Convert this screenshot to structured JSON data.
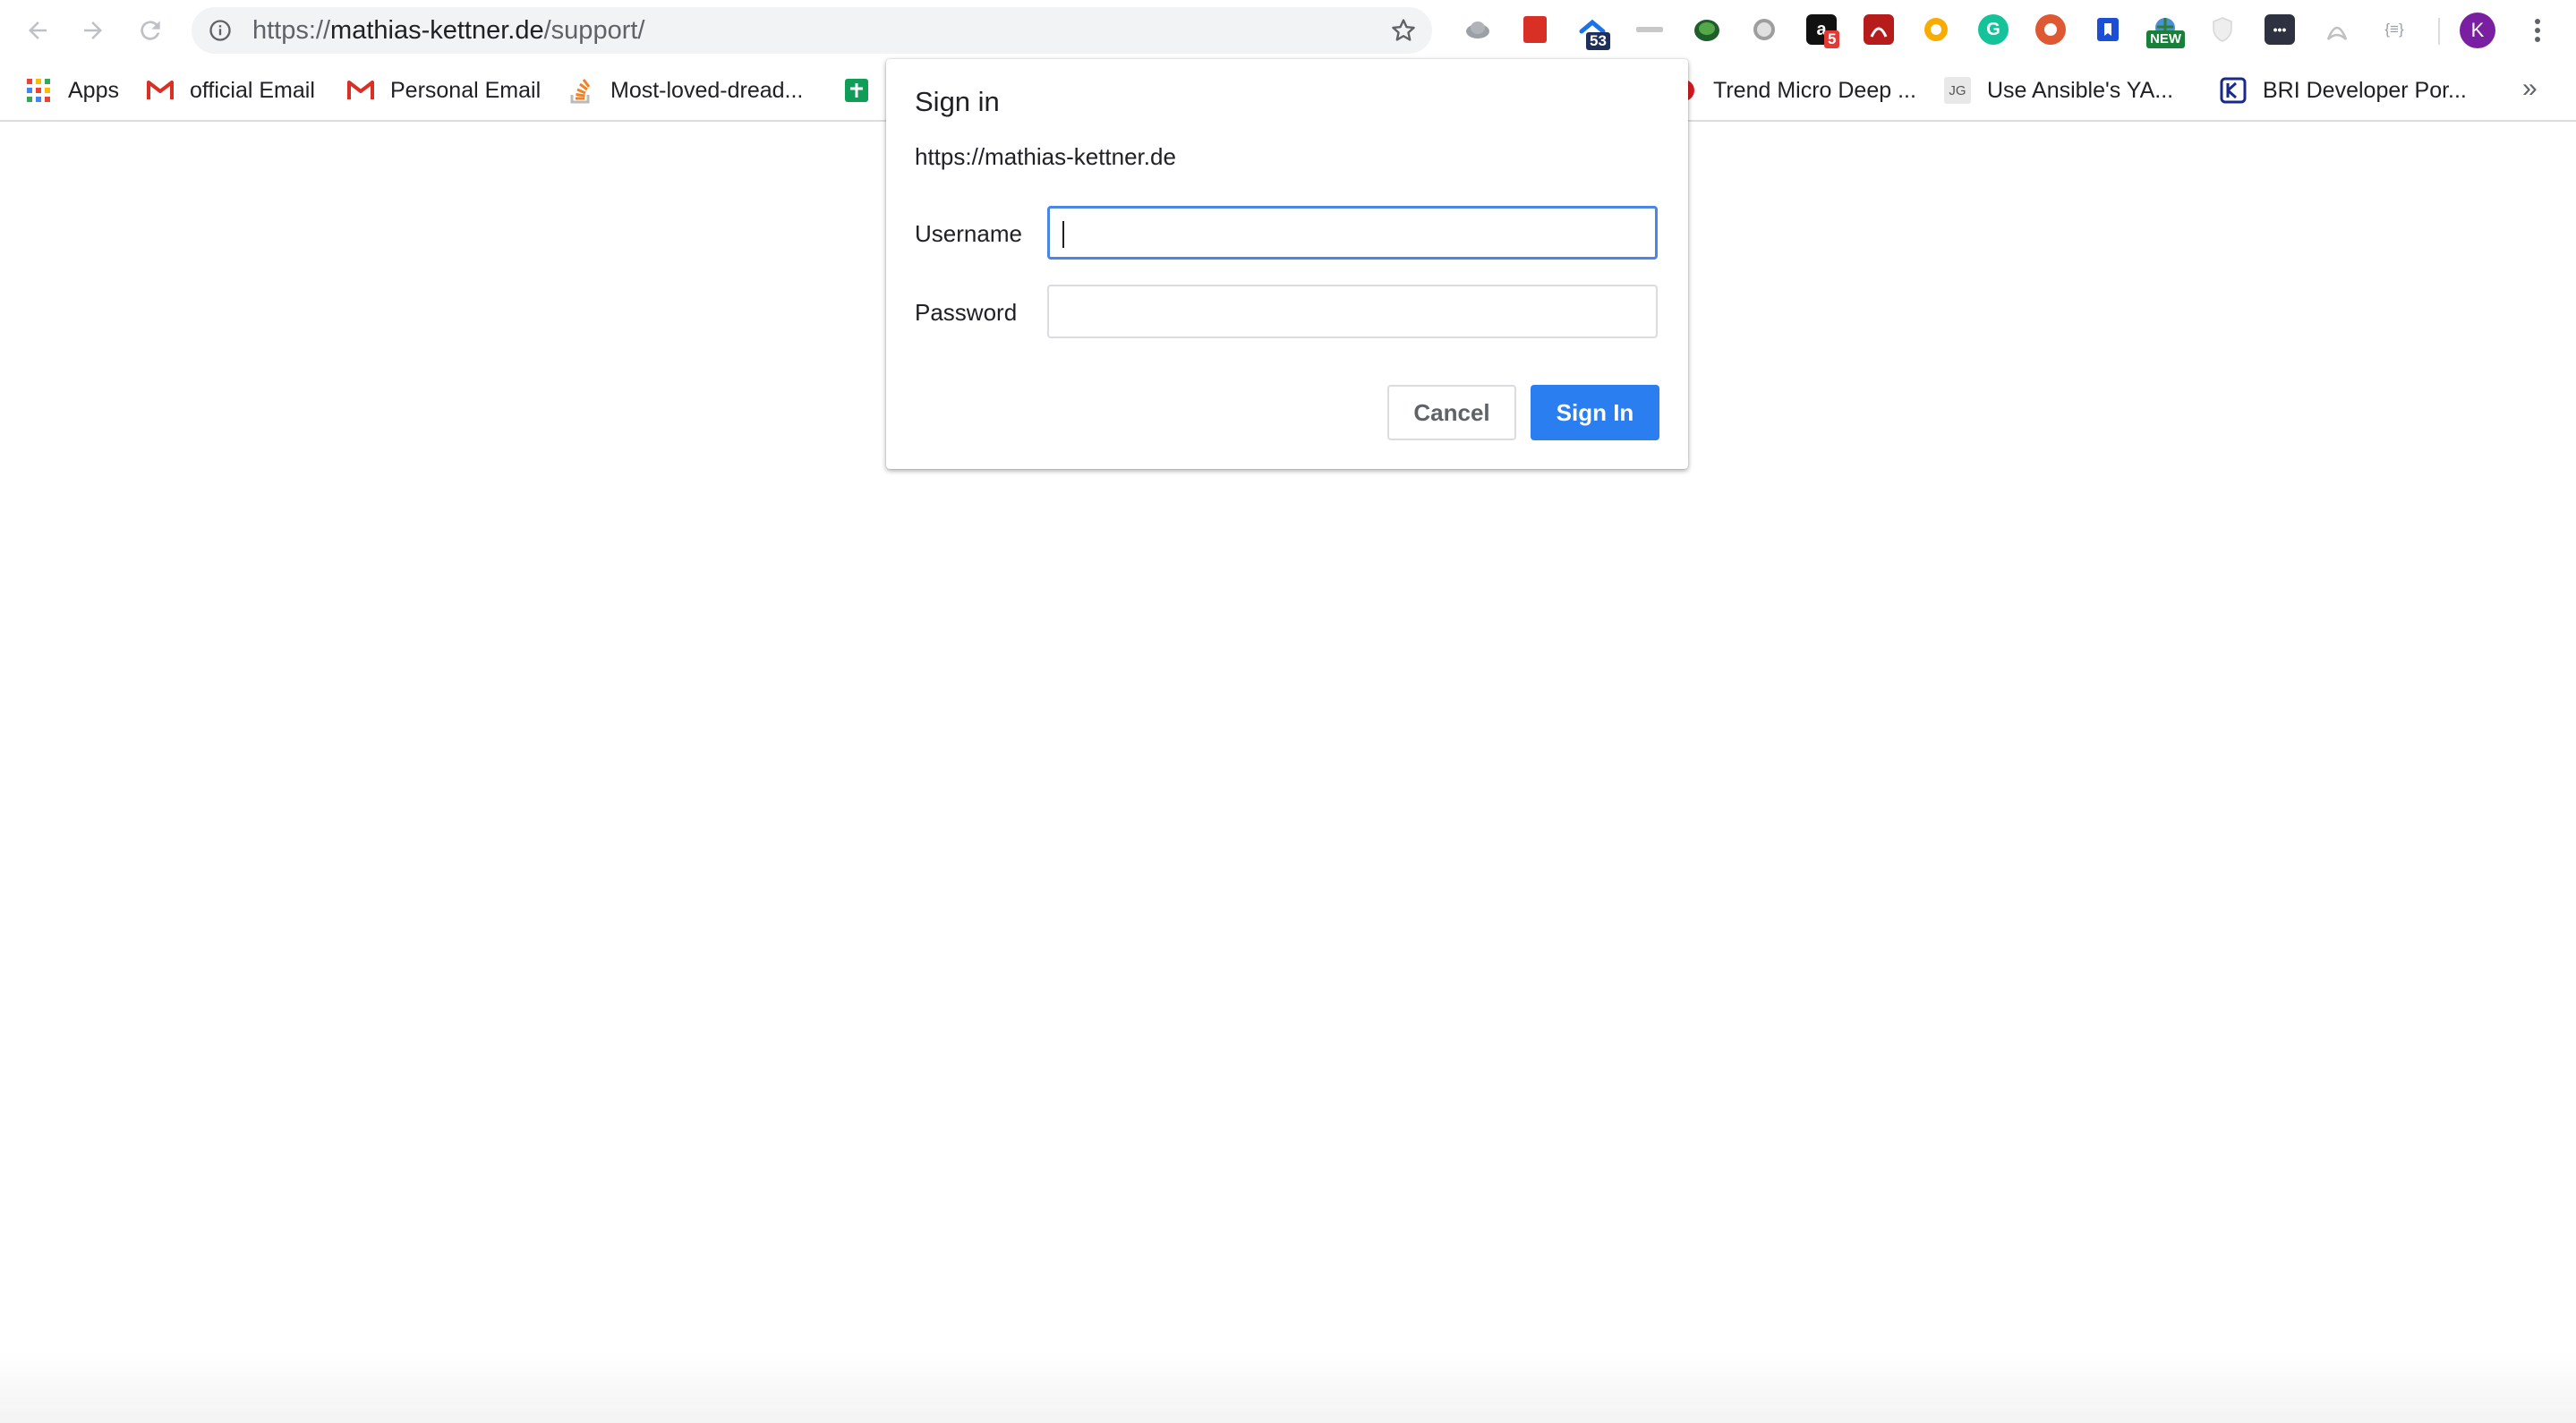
{
  "browser": {
    "url_scheme": "https://",
    "url_host": "mathias-kettner.de",
    "url_path": "/support/",
    "profile_initial": "K",
    "extensions": [
      {
        "icon": "cloud-extension-icon",
        "badge": ""
      },
      {
        "icon": "red-book-extension-icon",
        "badge": ""
      },
      {
        "icon": "blue-house-extension-icon",
        "badge": "53"
      },
      {
        "icon": "grey-bar-extension-icon",
        "badge": ""
      },
      {
        "icon": "turtle-extension-icon",
        "badge": ""
      },
      {
        "icon": "circle-extension-icon",
        "badge": ""
      },
      {
        "icon": "amazon-extension-icon",
        "glyph": "a",
        "badge": "5"
      },
      {
        "icon": "pdf-red-extension-icon",
        "badge": ""
      },
      {
        "icon": "orange-gear-extension-icon",
        "badge": ""
      },
      {
        "icon": "grammarly-extension-icon",
        "glyph": "G",
        "badge": ""
      },
      {
        "icon": "duckduckgo-extension-icon",
        "badge": ""
      },
      {
        "icon": "bookmark-blue-extension-icon",
        "badge": ""
      },
      {
        "icon": "globe-extension-icon",
        "badge": "NEW"
      },
      {
        "icon": "shield-extension-icon",
        "badge": ""
      },
      {
        "icon": "dots-extension-icon",
        "glyph": "•••",
        "badge": ""
      },
      {
        "icon": "acrobat-extension-icon",
        "badge": ""
      },
      {
        "icon": "json-extension-icon",
        "glyph": "{≡}",
        "badge": ""
      }
    ]
  },
  "bookmarks": [
    {
      "label": "Apps",
      "icon": "apps-grid-icon"
    },
    {
      "label": "official Email",
      "icon": "gmail-icon"
    },
    {
      "label": "Personal Email",
      "icon": "gmail-icon"
    },
    {
      "label": "Most-loved-dread...",
      "icon": "stackoverflow-icon"
    },
    {
      "label": "",
      "icon": "google-sheets-icon"
    },
    {
      "label": "Trend Micro Deep ...",
      "icon": "trend-micro-icon"
    },
    {
      "label": "Use Ansible's YA...",
      "icon": "jg-icon",
      "glyph": "JG"
    },
    {
      "label": "BRI Developer Por...",
      "icon": "bri-icon"
    }
  ],
  "bookmarks_more": "»",
  "dialog": {
    "title": "Sign in",
    "origin": "https://mathias-kettner.de",
    "username_label": "Username",
    "password_label": "Password",
    "username_value": "",
    "password_value": "",
    "cancel_label": "Cancel",
    "signin_label": "Sign In"
  },
  "colors": {
    "accent": "#2a7ef0",
    "focus_border": "#4a86e8",
    "avatar": "#7b1fa2"
  }
}
